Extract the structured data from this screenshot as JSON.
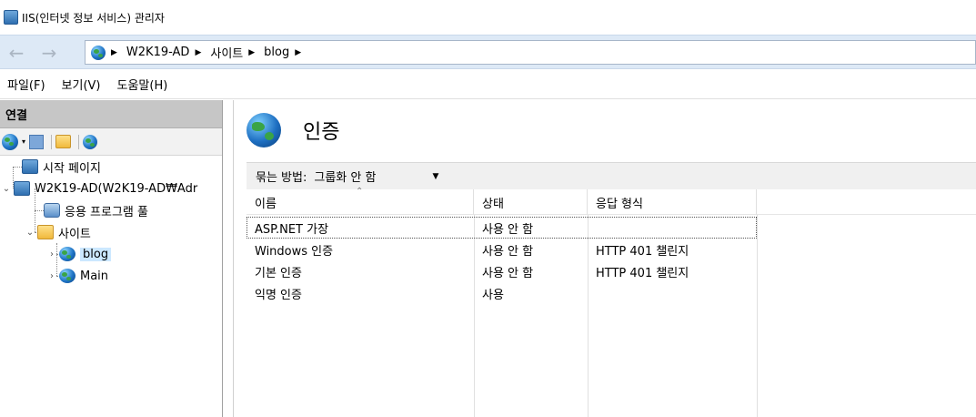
{
  "window": {
    "title": "IIS(인터넷 정보 서비스) 관리자"
  },
  "address": {
    "crumbs": [
      "W2K19-AD",
      "사이트",
      "blog"
    ]
  },
  "menu": {
    "items": [
      "파일(F)",
      "보기(V)",
      "도움말(H)"
    ]
  },
  "connections": {
    "header": "연결",
    "tree": {
      "start_page": "시작 페이지",
      "server": "W2K19-AD(W2K19-AD₩Adr",
      "app_pools": "응용 프로그램 풀",
      "sites": "사이트",
      "site_blog": "blog",
      "site_main": "Main"
    }
  },
  "main": {
    "heading": "인증",
    "group_by_label": "묶는 방법:",
    "group_by_value": "그룹화 안 함",
    "columns": [
      "이름",
      "상태",
      "응답 형식"
    ],
    "rows": [
      {
        "name": "ASP.NET 가장",
        "status": "사용 안 함",
        "response": ""
      },
      {
        "name": "Windows 인증",
        "status": "사용 안 함",
        "response": "HTTP 401 챌린지"
      },
      {
        "name": "기본 인증",
        "status": "사용 안 함",
        "response": "HTTP 401 챌린지"
      },
      {
        "name": "익명 인증",
        "status": "사용",
        "response": ""
      }
    ]
  }
}
